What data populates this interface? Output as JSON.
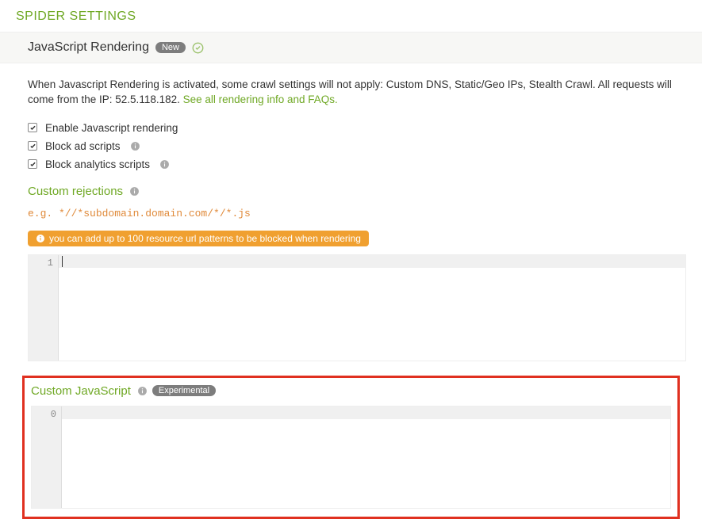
{
  "page_title": "SPIDER SETTINGS",
  "section": {
    "title": "JavaScript Rendering",
    "badge_new": "New"
  },
  "description": {
    "text_prefix": "When Javascript Rendering is activated, some crawl settings will not apply: Custom DNS, Static/Geo IPs, Stealth Crawl. All requests will come from the IP: 52.5.118.182. ",
    "link_text": "See all rendering info and FAQs."
  },
  "checkboxes": {
    "enable_js": {
      "label": "Enable Javascript rendering",
      "checked": true
    },
    "block_ads": {
      "label": "Block ad scripts",
      "checked": true
    },
    "block_analytics": {
      "label": "Block analytics scripts",
      "checked": true
    }
  },
  "custom_rejections": {
    "title": "Custom rejections",
    "example": "e.g. *//*subdomain.domain.com/*/*.js",
    "hint": "you can add up to 100 resource url patterns to be blocked when rendering",
    "editor": {
      "line_number": "1"
    }
  },
  "custom_js": {
    "title": "Custom JavaScript",
    "badge": "Experimental",
    "editor": {
      "line_number": "0"
    }
  }
}
